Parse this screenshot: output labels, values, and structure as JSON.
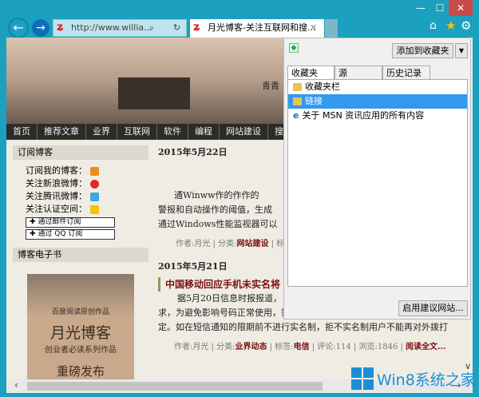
{
  "window": {
    "minimize": "—",
    "maximize": "☐",
    "close": "✕"
  },
  "toolbar": {
    "address": "http://www.willia...",
    "search_icon": "⌕",
    "tab_title": "月光博客-关注互联网和搜...",
    "tab_close": "✕"
  },
  "page": {
    "nav": [
      "首页",
      "推荐文章",
      "业界",
      "互联网",
      "软件",
      "编程",
      "网站建设",
      "搜索引"
    ],
    "banner_text": "青青",
    "sidebar": {
      "subscribe_title": "订阅博客",
      "items": [
        "订阅我的博客：",
        "关注新浪微博：",
        "关注腾讯微博：",
        "关注认证空间："
      ],
      "email_btn": "通过邮件订阅",
      "qq_btn": "通过 QQ 订阅",
      "ebook_title": "博客电子书",
      "book": {
        "line1": "百度阅读原创作品",
        "title": "月光博客",
        "line2": "创业者必读系列作品",
        "line3": "重磅发布"
      }
    },
    "posts": [
      {
        "date": "2015年5月22日",
        "lines": [
          "通Winww作的作作的",
          "警报和自动操作的阈值，生成",
          "通过Windows性能监视器可以"
        ],
        "meta_author": "作者:月光 | 分类:",
        "meta_cat": "网站建设",
        "meta_rest": " | 标"
      },
      {
        "date": "2015年5月21日",
        "title": "中国移动回应手机未实名将",
        "lines": [
          "据5月20日信息时报报道，",
          "求，为避免影响号码正常使用，需携带本人身份证进行实名登记。广州移动",
          "定。如在短信通知的限期前不进行实名制，拒不实名制用户不能再对外拨打"
        ],
        "meta_author": "作者:月光 | 分类:",
        "meta_cat": "业界动态",
        "meta_tag_label": " | 标签:",
        "meta_tag": "电信",
        "meta_rest": " | 评论:114 | 浏览:1846 | ",
        "meta_more": "阅读全文..."
      }
    ]
  },
  "favorites": {
    "add_button": "添加到收藏夹",
    "tabs": [
      "收藏夹",
      "源",
      "历史记录"
    ],
    "items": [
      "收藏夹栏",
      "链接",
      "关于 MSN 资讯应用的所有内容"
    ],
    "suggest_button": "启用建议网站..."
  },
  "watermark": "Win8系统之家"
}
